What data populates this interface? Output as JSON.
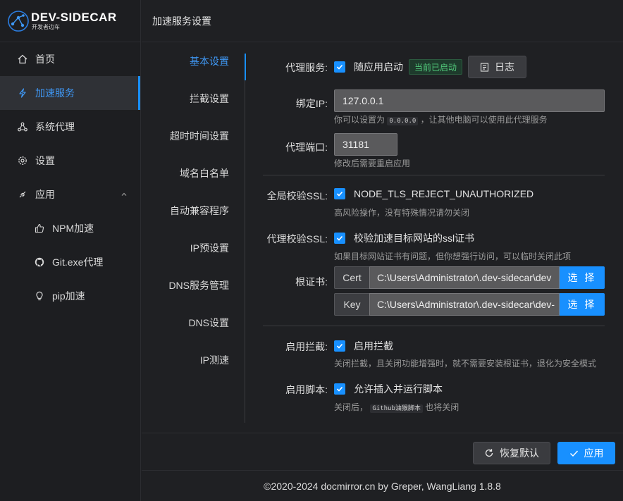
{
  "app": {
    "logo_title": "DEV-SIDECAR",
    "logo_subtitle": "开发者边车"
  },
  "sidebar": {
    "items": [
      {
        "label": "首页",
        "icon": "home-icon"
      },
      {
        "label": "加速服务",
        "icon": "thunderbolt-icon",
        "active": true
      },
      {
        "label": "系统代理",
        "icon": "share-icon"
      },
      {
        "label": "设置",
        "icon": "gear-icon"
      },
      {
        "label": "应用",
        "icon": "api-icon",
        "expanded": true
      }
    ],
    "subitems": [
      {
        "label": "NPM加速",
        "icon": "thumbs-up-icon"
      },
      {
        "label": "Git.exe代理",
        "icon": "github-icon"
      },
      {
        "label": "pip加速",
        "icon": "bulb-icon"
      }
    ]
  },
  "header": {
    "title": "加速服务设置"
  },
  "tabs": [
    "基本设置",
    "拦截设置",
    "超时时间设置",
    "域名白名单",
    "自动兼容程序",
    "IP预设置",
    "DNS服务管理",
    "DNS设置",
    "IP测速"
  ],
  "active_tab": "基本设置",
  "form": {
    "proxy_service": {
      "label": "代理服务:",
      "checkbox_label": "随应用启动",
      "checked": true,
      "status": "当前已启动",
      "log_button": "日志"
    },
    "bind_ip": {
      "label": "绑定IP:",
      "value": "127.0.0.1",
      "hint_before": "你可以设置为",
      "hint_code": "0.0.0.0",
      "hint_after": "，让其他电脑可以使用此代理服务"
    },
    "proxy_port": {
      "label": "代理端口:",
      "value": "31181",
      "hint": "修改后需要重启应用"
    },
    "global_ssl": {
      "label": "全局校验SSL:",
      "checkbox_label": "NODE_TLS_REJECT_UNAUTHORIZED",
      "checked": true,
      "hint": "高风险操作，没有特殊情况请勿关闭"
    },
    "proxy_ssl": {
      "label": "代理校验SSL:",
      "checkbox_label": "校验加速目标网站的ssl证书",
      "checked": true,
      "hint": "如果目标网站证书有问题，但你想强行访问，可以临时关闭此项"
    },
    "root_cert": {
      "label": "根证书:",
      "cert_addon": "Cert",
      "cert_path": "C:\\Users\\Administrator\\.dev-sidecar\\dev",
      "key_addon": "Key",
      "key_path": "C:\\Users\\Administrator\\.dev-sidecar\\dev-",
      "pick_label": "选 择"
    },
    "intercept": {
      "label": "启用拦截:",
      "checkbox_label": "启用拦截",
      "checked": true,
      "hint": "关闭拦截，且关闭功能增强时，就不需要安装根证书，退化为安全模式"
    },
    "script": {
      "label": "启用脚本:",
      "checkbox_label": "允许插入并运行脚本",
      "checked": true,
      "hint_before": "关闭后，",
      "hint_code": "Github油猴脚本",
      "hint_after": "也将关闭"
    }
  },
  "actions": {
    "reset": "恢复默认",
    "apply": "应用"
  },
  "footer": {
    "copyright": "©2020-2024 docmirror.cn by Greper, WangLiang 1.8.8"
  },
  "colors": {
    "accent": "#1890ff",
    "background": "#1f2023",
    "status_green": "#51c77a"
  }
}
